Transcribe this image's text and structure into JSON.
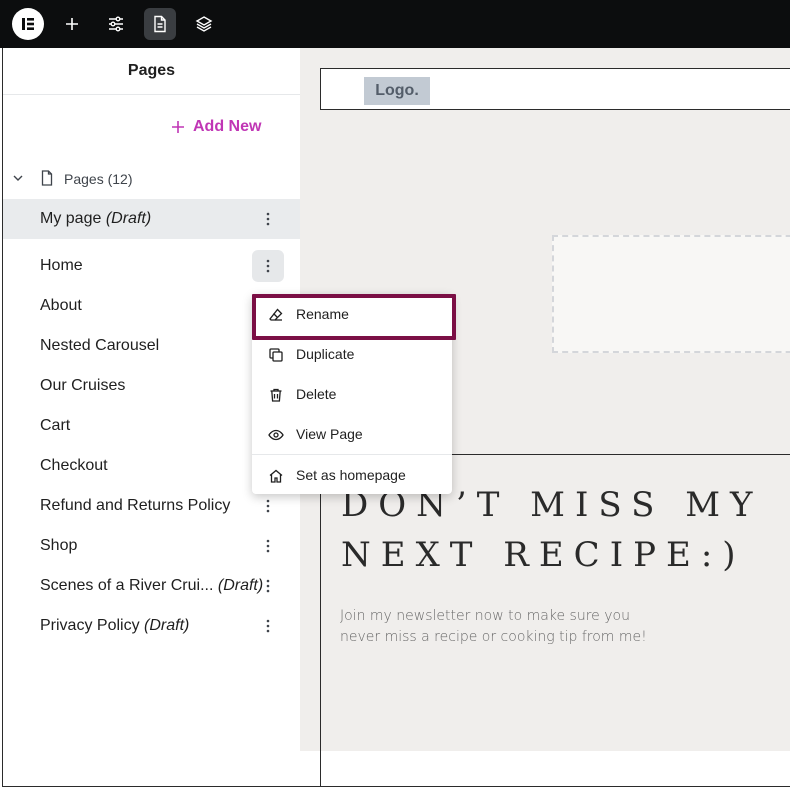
{
  "panel": {
    "title": "Pages",
    "add_new": "Add New",
    "tree_root": "Pages (12)",
    "draft_label": "(Draft)"
  },
  "pages": [
    {
      "name": "My page",
      "draft": "(Draft)"
    },
    {
      "name": "Home",
      "draft": ""
    },
    {
      "name": "About",
      "draft": ""
    },
    {
      "name": "Nested Carousel",
      "draft": ""
    },
    {
      "name": "Our Cruises",
      "draft": ""
    },
    {
      "name": "Cart",
      "draft": ""
    },
    {
      "name": "Checkout",
      "draft": ""
    },
    {
      "name": "Refund and Returns Policy",
      "draft": ""
    },
    {
      "name": "Shop",
      "draft": ""
    },
    {
      "name": "Scenes of a River Crui...",
      "draft": "(Draft)"
    },
    {
      "name": "Privacy Policy",
      "draft": "(Draft)"
    }
  ],
  "context_menu": {
    "rename": "Rename",
    "duplicate": "Duplicate",
    "delete": "Delete",
    "view_page": "View Page",
    "set_homepage": "Set as homepage"
  },
  "canvas": {
    "logo": "Logo.",
    "headline_line1": "DON’T MISS MY",
    "headline_line2": "NEXT RECIPE:)",
    "subcopy": "Join my newsletter now to make sure you never miss a recipe or cooking tip from me!"
  },
  "icons": {
    "toolbar": [
      "elementor-logo-icon",
      "plus-icon",
      "sliders-icon",
      "page-icon",
      "layers-icon"
    ]
  },
  "colors": {
    "accent": "#c036b5",
    "highlight_border": "#7b0f45",
    "toolbar_bg": "#0c0d0e"
  }
}
